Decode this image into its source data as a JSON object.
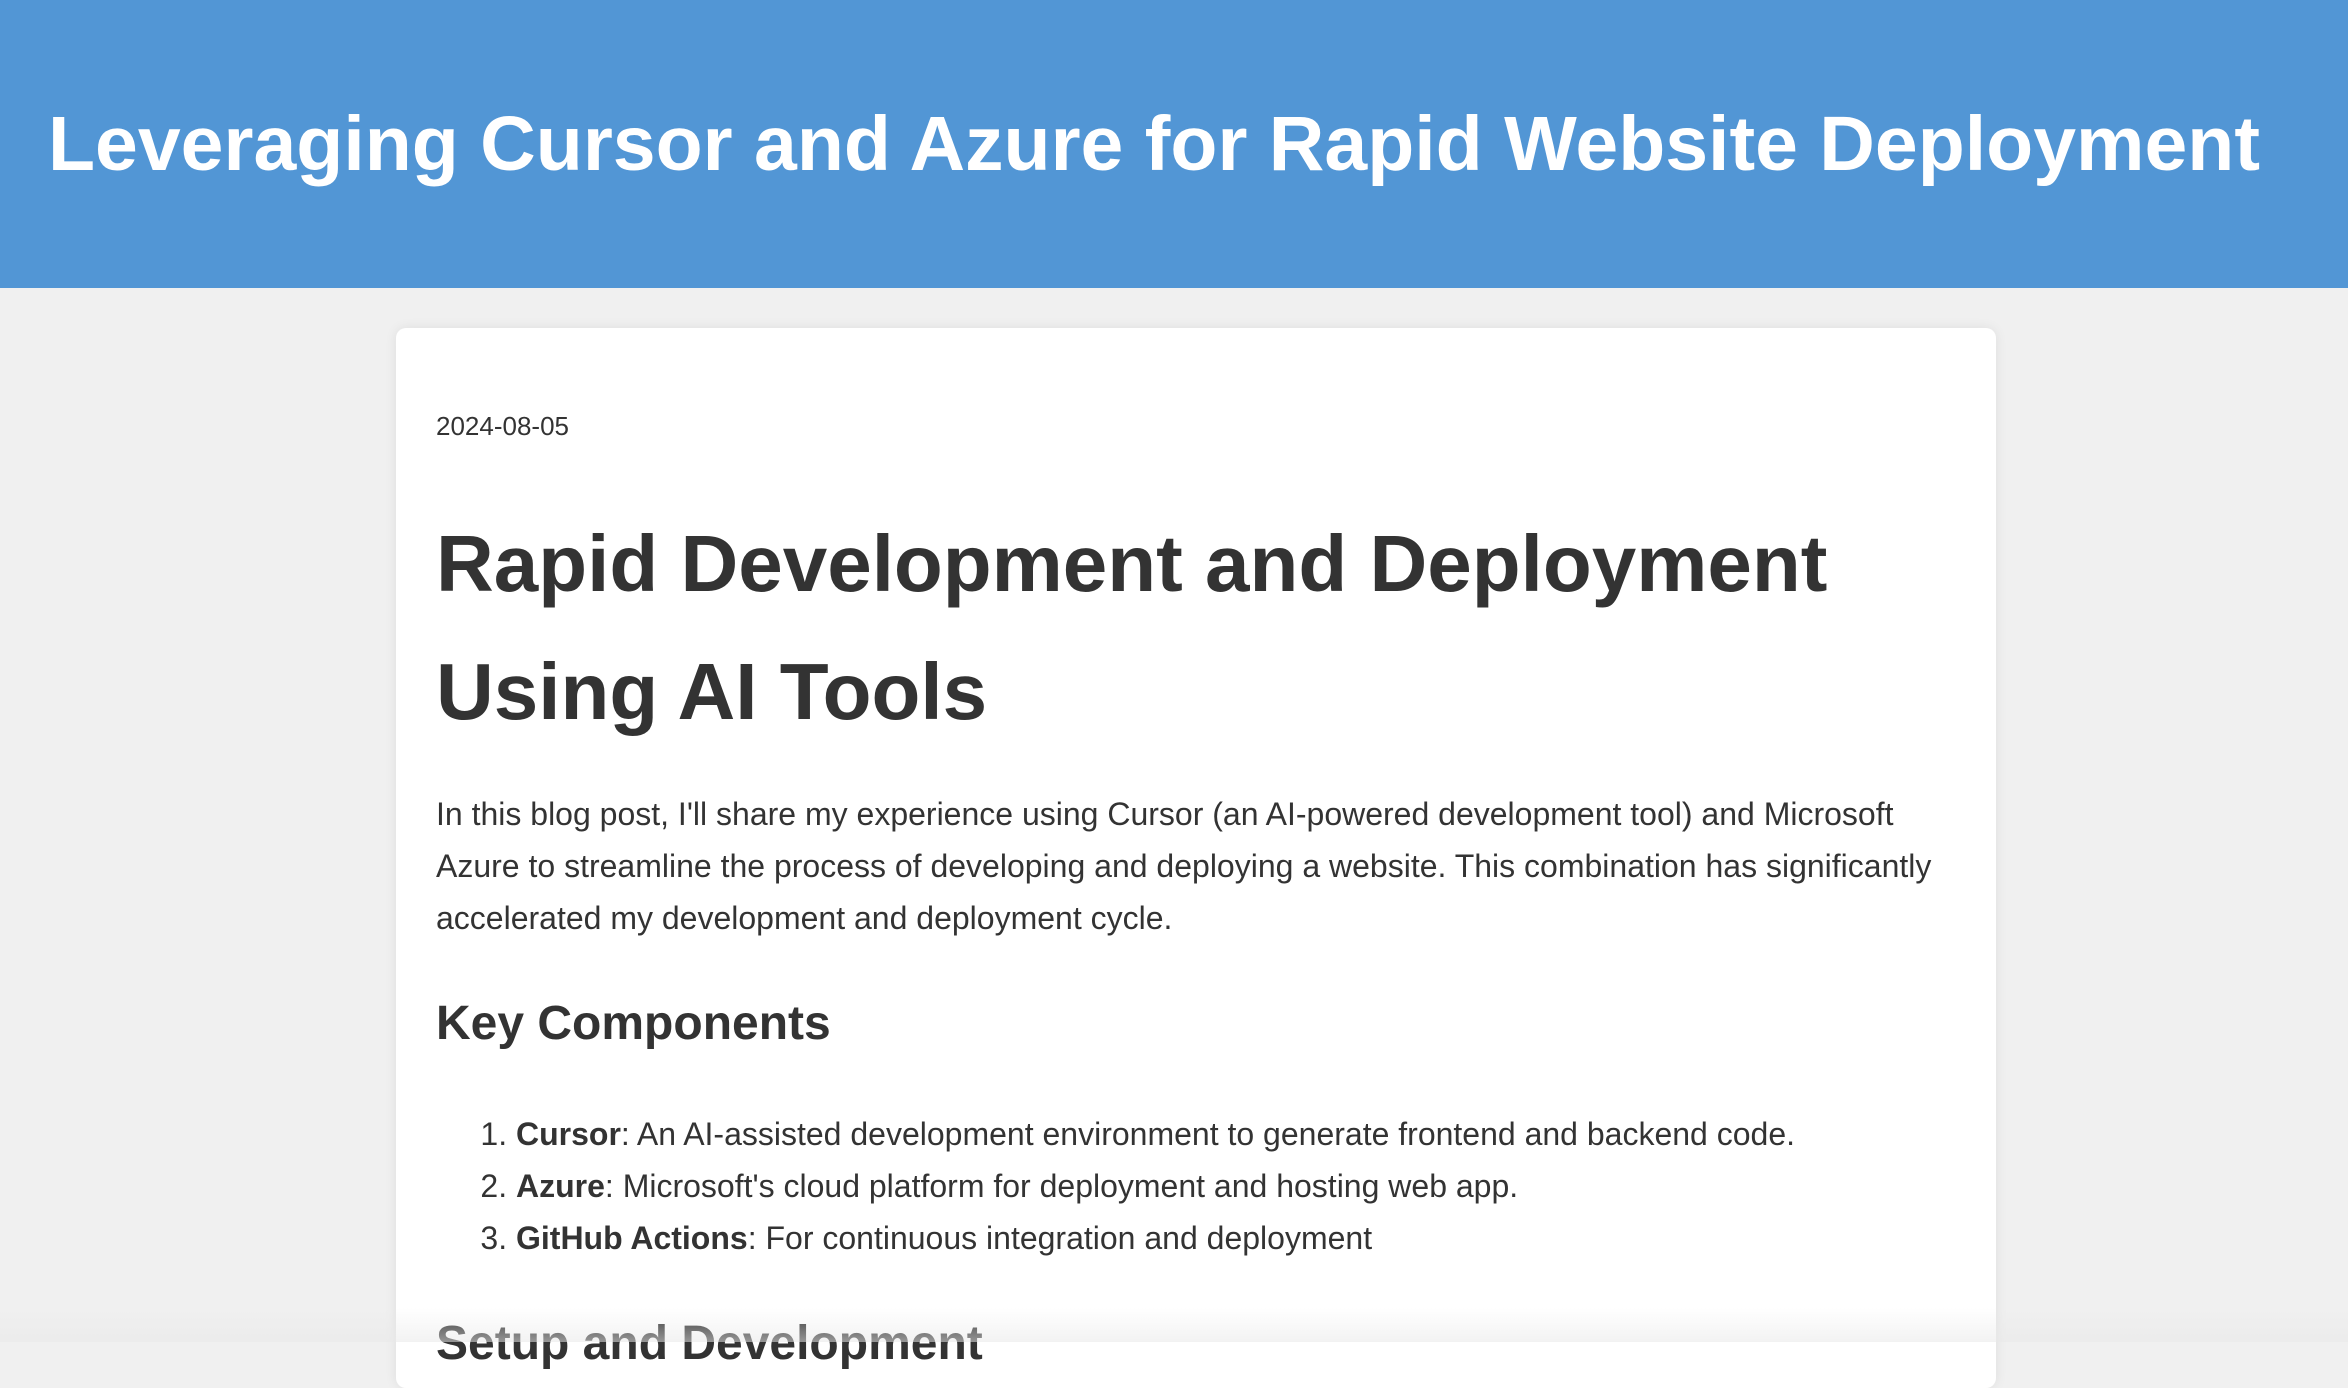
{
  "header": {
    "title": "Leveraging Cursor and Azure for Rapid Website Deployment"
  },
  "post": {
    "date": "2024-08-05",
    "heading": "Rapid Development and Deployment Using AI Tools",
    "intro": "In this blog post, I'll share my experience using Cursor (an AI-powered development tool) and Microsoft Azure to streamline the process of developing and deploying a website. This combination has significantly accelerated my development and deployment cycle.",
    "sections": [
      {
        "heading": "Key Components",
        "items": [
          {
            "name": "Cursor",
            "desc": ": An AI-assisted development environment to generate frontend and backend code."
          },
          {
            "name": "Azure",
            "desc": ": Microsoft's cloud platform for deployment and hosting web app."
          },
          {
            "name": "GitHub Actions",
            "desc": ": For continuous integration and deployment"
          }
        ]
      },
      {
        "heading": "Setup and Development"
      }
    ]
  },
  "colors": {
    "header_bg": "#5296d5",
    "page_bg": "#f0f0f0",
    "card_bg": "#ffffff",
    "text": "#333333"
  }
}
